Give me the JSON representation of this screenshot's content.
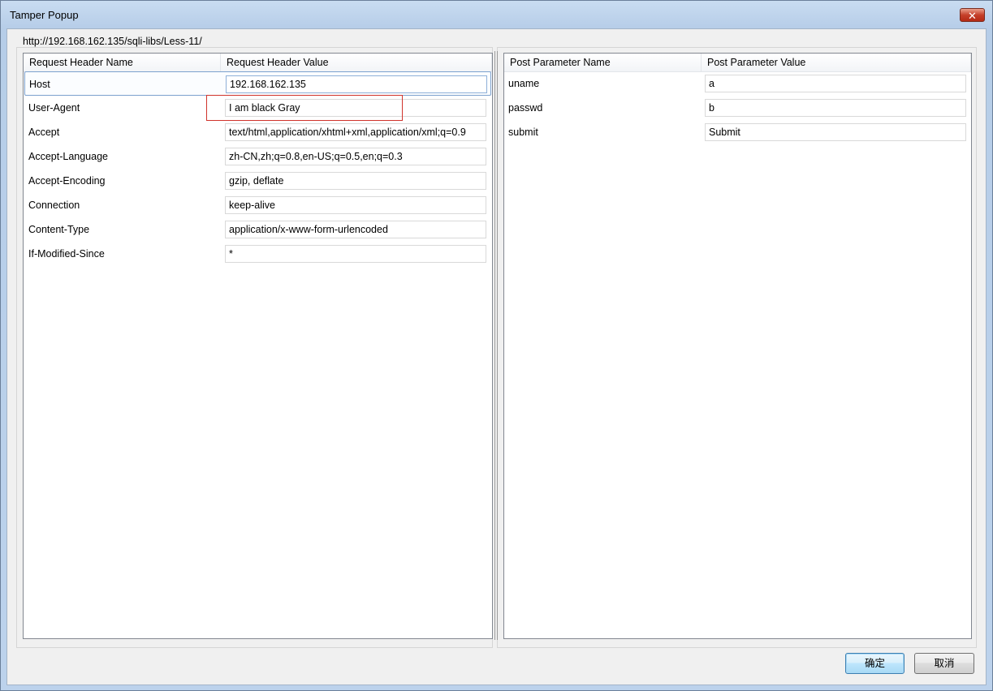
{
  "window": {
    "title": "Tamper Popup",
    "close_glyph": "✕"
  },
  "url": "http://192.168.162.135/sqli-libs/Less-11/",
  "headers_table": {
    "col_name": "Request Header Name",
    "col_value": "Request Header Value",
    "rows": [
      {
        "name": "Host",
        "value": "192.168.162.135"
      },
      {
        "name": "User-Agent",
        "value": "I am black Gray"
      },
      {
        "name": "Accept",
        "value": "text/html,application/xhtml+xml,application/xml;q=0.9"
      },
      {
        "name": "Accept-Language",
        "value": "zh-CN,zh;q=0.8,en-US;q=0.5,en;q=0.3"
      },
      {
        "name": "Accept-Encoding",
        "value": "gzip, deflate"
      },
      {
        "name": "Connection",
        "value": "keep-alive"
      },
      {
        "name": "Content-Type",
        "value": "application/x-www-form-urlencoded"
      },
      {
        "name": "If-Modified-Since",
        "value": "*"
      }
    ]
  },
  "params_table": {
    "col_name": "Post Parameter Name",
    "col_value": "Post Parameter Value",
    "rows": [
      {
        "name": "uname",
        "value": "a"
      },
      {
        "name": "passwd",
        "value": "b"
      },
      {
        "name": "submit",
        "value": "Submit"
      }
    ]
  },
  "buttons": {
    "ok": "确定",
    "cancel": "取消"
  },
  "colors": {
    "highlight_border": "#d0342c",
    "selected_row_border": "#7da2ce"
  }
}
